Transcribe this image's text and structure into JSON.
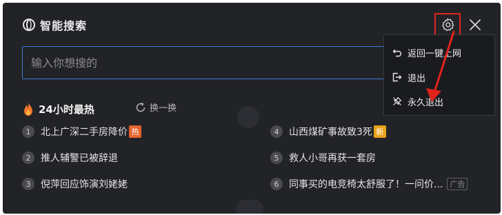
{
  "header": {
    "title": "智能搜索"
  },
  "search": {
    "placeholder": "输入你想搜的"
  },
  "hot": {
    "title": "24小时最热",
    "refresh_label": "换一换",
    "items": [
      {
        "rank": "1",
        "text": "北上广深二手房降价",
        "badge": "热"
      },
      {
        "rank": "2",
        "text": "推人辅警已被辞退"
      },
      {
        "rank": "3",
        "text": "倪萍回应饰演刘姥姥"
      },
      {
        "rank": "4",
        "text": "山西煤矿事故致3死",
        "badge": "新"
      },
      {
        "rank": "5",
        "text": "救人小哥再获一套房"
      },
      {
        "rank": "6",
        "text": "同事买的电竞椅太舒服了！一问价...",
        "tag": "广告"
      }
    ]
  },
  "menu": {
    "items": [
      {
        "label": "返回一键上网",
        "icon": "return-icon"
      },
      {
        "label": "退出",
        "icon": "exit-icon"
      },
      {
        "label": "永久退出",
        "icon": "pin-off-icon"
      }
    ]
  },
  "colors": {
    "panel_bg": "#222327",
    "accent_border": "#3d7bd8",
    "highlight_red": "#e0241b",
    "hot_badge": "#e8642c",
    "new_badge": "#e9a31b"
  }
}
